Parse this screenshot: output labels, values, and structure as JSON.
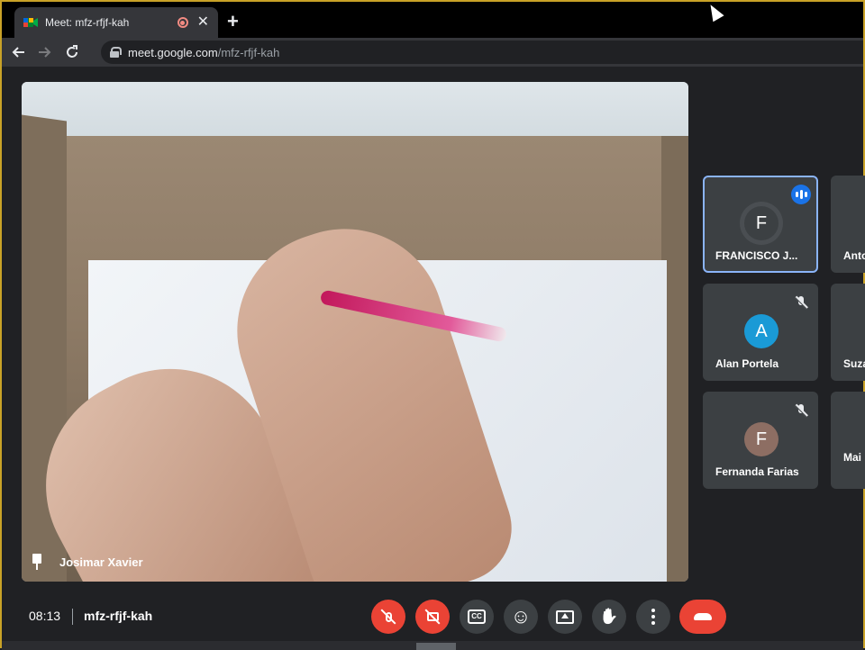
{
  "browser": {
    "tab_title": "Meet: mfz-rfjf-kah",
    "new_tab_label": "+",
    "close_label": "✕",
    "url_host": "meet.google.com",
    "url_path": "/mfz-rfjf-kah"
  },
  "main_video": {
    "participant_name": "Josimar Xavier"
  },
  "participants": [
    {
      "initial": "F",
      "name": "FRANCISCO J...",
      "avatar_color": "#3c4043",
      "speaking": true
    },
    {
      "initial": "A",
      "name": "Alan Portela",
      "avatar_color": "#1a9ad6",
      "muted": true
    },
    {
      "initial": "F",
      "name": "Fernanda Farias",
      "avatar_color": "#8d6e63",
      "muted": true
    }
  ],
  "participants_partial": [
    {
      "name": "Anto"
    },
    {
      "name": "Suza"
    },
    {
      "name": "Mai"
    }
  ],
  "meeting": {
    "time": "08:13",
    "code": "mfz-rfjf-kah"
  },
  "controls": {
    "cc_label": "CC",
    "emoji_glyph": "☺",
    "hand_glyph": "✋"
  },
  "colors": {
    "accent_blue": "#8ab4f8",
    "danger_red": "#ea4335",
    "background": "#202124"
  }
}
